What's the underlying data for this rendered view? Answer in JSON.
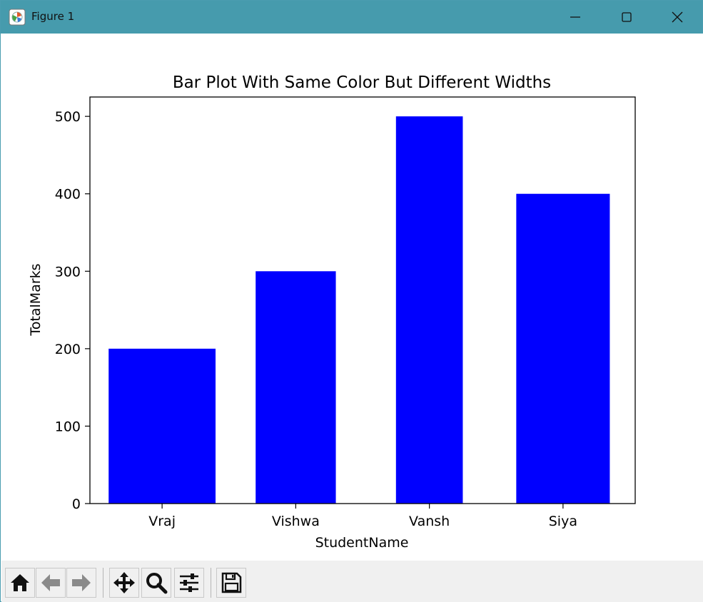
{
  "window": {
    "title": "Figure 1",
    "app_icon": "matplotlib-figure-icon",
    "titlebar_color": "#469bad",
    "controls": [
      "minimize-icon",
      "maximize-icon",
      "close-icon"
    ]
  },
  "toolbar": {
    "buttons": [
      {
        "name": "home",
        "icon": "home-icon"
      },
      {
        "name": "back",
        "icon": "arrow-left-icon"
      },
      {
        "name": "forward",
        "icon": "arrow-right-icon"
      },
      {
        "name": "pan",
        "icon": "move-arrows-icon"
      },
      {
        "name": "zoom",
        "icon": "magnifier-icon"
      },
      {
        "name": "configure-subplots",
        "icon": "sliders-icon"
      },
      {
        "name": "save",
        "icon": "floppy-disk-icon"
      }
    ]
  },
  "chart_data": {
    "type": "bar",
    "title": "Bar Plot With Same Color But Different Widths",
    "xlabel": "StudentName",
    "ylabel": "TotalMarks",
    "categories": [
      "Vraj",
      "Vishwa",
      "Vansh",
      "Siya"
    ],
    "values": [
      200,
      300,
      500,
      400
    ],
    "bar_widths": [
      0.8,
      0.6,
      0.5,
      0.7
    ],
    "bar_color": "#0000ff",
    "ylim": [
      0,
      525
    ],
    "yticks": [
      0,
      100,
      200,
      300,
      400,
      500
    ],
    "xlim": [
      -0.54,
      3.54
    ],
    "grid": false,
    "legend": "none"
  }
}
